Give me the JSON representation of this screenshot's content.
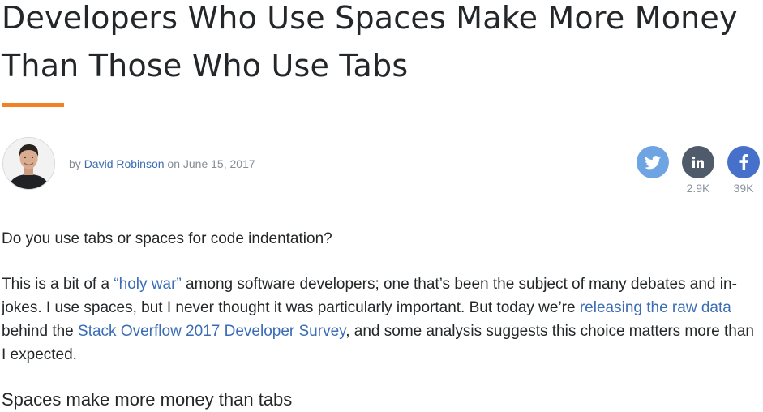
{
  "article": {
    "title_line1": "Developers Who Use Spaces Make More Money",
    "title_line2": "Than Those Who Use Tabs"
  },
  "byline": {
    "prefix": "by",
    "author": "David Robinson",
    "connector": "on",
    "date": "June 15, 2017"
  },
  "share": {
    "twitter_icon": "twitter-icon",
    "linkedin_icon": "linkedin-icon",
    "linkedin_count": "2.9K",
    "facebook_icon": "facebook-icon",
    "facebook_count": "39K"
  },
  "body": {
    "p1": "Do you use tabs or spaces for code indentation?",
    "p2_a": "This is a bit of a ",
    "p2_link1": "“holy war”",
    "p2_b": " among software developers; one that’s been the subject of many debates and in-jokes. I use spaces, but I never thought it was particularly important. But today we’re ",
    "p2_link2": "releasing the raw data",
    "p2_c": " behind the ",
    "p2_link3": "Stack Overflow 2017 Developer Survey",
    "p2_d": ", and some analysis suggests this choice matters more than I expected.",
    "subheading": "Spaces make more money than tabs"
  },
  "colors": {
    "accent_rule": "#f48024",
    "link": "#3b6db5",
    "twitter": "#6fa4e3",
    "linkedin": "#4f5b6b",
    "facebook": "#4670c9"
  }
}
